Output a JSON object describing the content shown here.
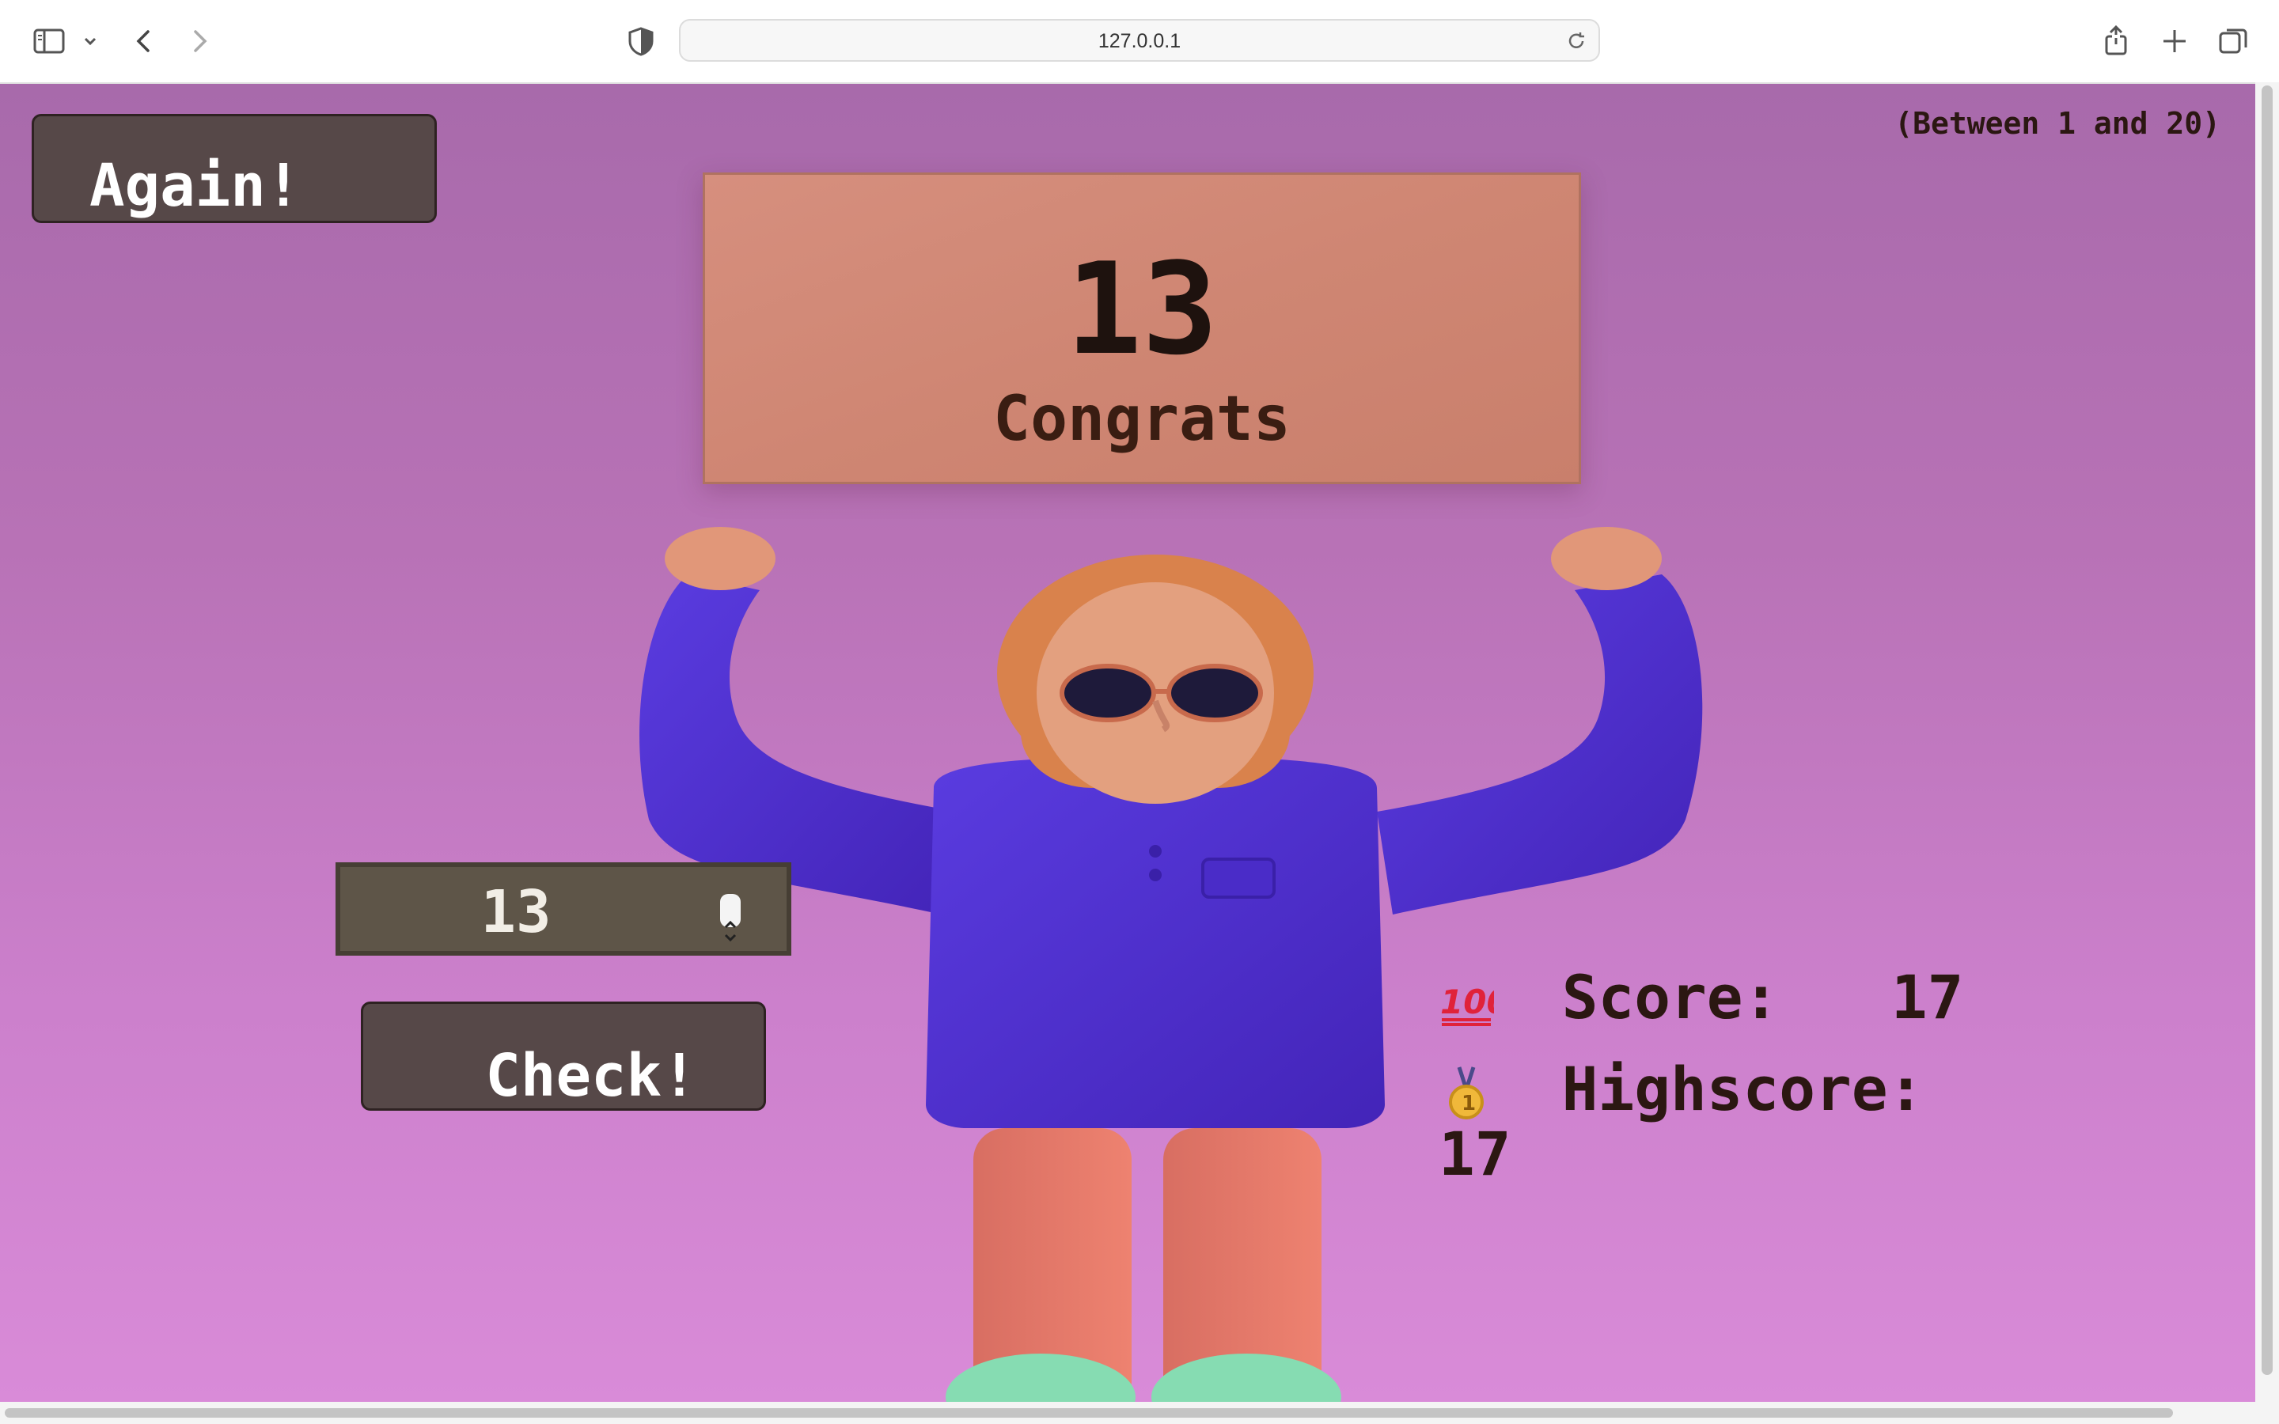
{
  "browser": {
    "url": "127.0.0.1",
    "icons": [
      "sidebar-icon",
      "chevron-down-icon",
      "back-icon",
      "forward-icon",
      "shield-icon",
      "reload-icon",
      "share-icon",
      "new-tab-icon",
      "tabs-overview-icon"
    ]
  },
  "game": {
    "again_label": "Again!",
    "range_hint": "(Between 1 and 20)",
    "secret_number": "13",
    "message": "Congrats",
    "guess_value": "13",
    "check_label": "Check!",
    "score_label": "Score:",
    "score_value": "17",
    "highscore_label": "Highscore:",
    "highscore_value": "17",
    "score_icon": "hundred-points-icon",
    "highscore_icon": "medal-icon"
  },
  "colors": {
    "page_background": "#b872b6",
    "button_background": "#564848",
    "input_background": "#5e5548",
    "sign_color": "#cf8673",
    "text_dark": "#2b1712"
  }
}
